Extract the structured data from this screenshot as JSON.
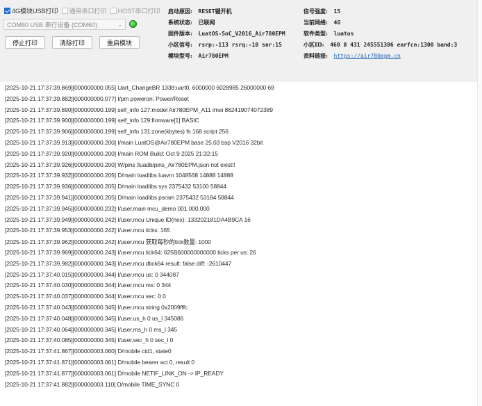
{
  "toolbar": {
    "checkboxes": [
      {
        "label": "4G模块USB打印",
        "checked": true,
        "enabled": true
      },
      {
        "label": "通用串口打印",
        "checked": false,
        "enabled": false
      },
      {
        "label": "HOST串口打印",
        "checked": false,
        "enabled": false
      }
    ],
    "port_select": "COM60 USB 串行设备 (COM60)",
    "buttons": {
      "stop_print": "停止打印",
      "clear_print": "清除打印",
      "restart_module": "重启模块"
    }
  },
  "info": {
    "boot_reason": {
      "label": "启动原因:",
      "value": "RESET键开机"
    },
    "system_status": {
      "label": "系统状态:",
      "value": "已联网"
    },
    "firmware": {
      "label": "固件版本:",
      "value": "LuatOS-SoC_V2016_Air780EPM"
    },
    "cell_signal": {
      "label": "小区信号:",
      "value": "rsrp:-113 rsrq:-10 snr:15"
    },
    "module_model": {
      "label": "模块型号:",
      "value": "Air780EPM"
    },
    "signal_strength": {
      "label": "信号强度:",
      "value": "15"
    },
    "current_network": {
      "label": "当前网络:",
      "value": "4G"
    },
    "software_type": {
      "label": "软件类型:",
      "value": "luatos"
    },
    "cell_id": {
      "label": "小区ID:",
      "value": "460 0 431 245551306 earfcn:1300 band:3"
    },
    "resource_link": {
      "label": "资料链接:",
      "value": "https://air780epm.cn"
    }
  },
  "log": [
    "[2025-10-21 17:37:39.869][000000000.055] Uart_ChangeBR 1338:uart0, 6000000 6028985 26000000 69",
    "[2025-10-21 17:37:39.882][000000000.077] I/pm poweron: Power/Reset",
    "[2025-10-21 17:37:39.890][000000000.199] self_info 127:model Air780EPM_A11 imei 862419074072389",
    "[2025-10-21 17:37:39.900][000000000.199] self_info 129:firmware[1] BASIC",
    "[2025-10-21 17:37:39.906][000000000.199] self_info 131:zone(kbytes) fs 168 script 256",
    "[2025-10-21 17:37:39.913][000000000.200] I/main LuatOS@Air780EPM base 25.03 bsp V2016 32bit",
    "[2025-10-21 17:37:39.920][000000000.200] I/main ROM Build: Oct  9 2025 21:32:15",
    "[2025-10-21 17:37:39.926][000000000.200] W/pins /luadb/pins_Air780EPM.json not exist!!",
    "[2025-10-21 17:37:39.932][000000000.205] D/main loadlibs luavm 1048568 14888 14888",
    "[2025-10-21 17:37:39.936][000000000.205] D/main loadlibs sys   2375432 53100 58844",
    "[2025-10-21 17:37:39.941][000000000.205] D/main loadlibs psram 2375432 53184 58844",
    "[2025-10-21 17:37:39.945][000000000.232] I/user.main mcu_demo 001.000.000",
    "[2025-10-21 17:37:39.949][000000000.242] I/user.mcu Unique ID(hex): 133202181DA4B9CA 16",
    "[2025-10-21 17:37:39.953][000000000.242] I/user.mcu ticks: 165",
    "[2025-10-21 17:37:39.962][000000000.242] I/user.mcu 获取每秒的tick数量: 1000",
    "[2025-10-21 17:37:39.969][000000000.243] I/user.mcu tick64: 625B600000000000 ticks per us: 26",
    "[2025-10-21 17:37:39.982][000000000.343] I/user.mcu dtick64 result: false diff: -2610447",
    "[2025-10-21 17:37:40.015][000000000.344] I/user.mcu us: 0 344087",
    "[2025-10-21 17:37:40.030][000000000.344] I/user.mcu ms: 0 344",
    "[2025-10-21 17:37:40.037][000000000.344] I/user.mcu sec: 0 0",
    "[2025-10-21 17:37:40.043][000000000.345] I/user.mcu string 0x2009fffc",
    "[2025-10-21 17:37:40.048][000000000.345] I/user.us_h 0 us_l 345086",
    "[2025-10-21 17:37:40.064][000000000.345] I/user.ms_h 0 ms_l 345",
    "[2025-10-21 17:37:40.085][000000000.345] I/user.sec_h 0 sec_l 0",
    "[2025-10-21 17:37:41.867][000000003.060] D/mobile cid1, state0",
    "[2025-10-21 17:37:41.871][000000003.061] D/mobile bearer act 0, result 0",
    "[2025-10-21 17:37:41.877][000000003.061] D/mobile NETIF_LINK_ON -> IP_READY",
    "[2025-10-21 17:37:41.882][000000003.110] D/mobile TIME_SYNC 0"
  ]
}
